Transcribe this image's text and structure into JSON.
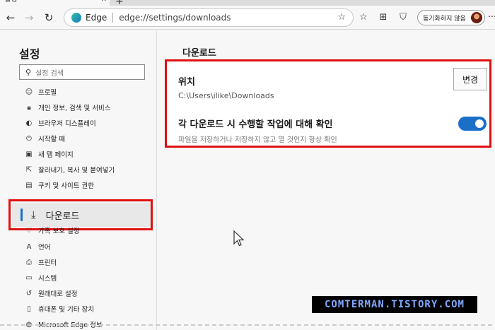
{
  "tab": {
    "title": "설정"
  },
  "toolbar": {
    "site_name": "Edge",
    "url": "edge://settings/downloads",
    "sync_label": "동기화하지 않음"
  },
  "sidebar": {
    "title": "설정",
    "search_placeholder": "설정 검색",
    "items": [
      {
        "label": "프로필",
        "icon": "profile-icon"
      },
      {
        "label": "개인 정보, 검색 및 서비스",
        "icon": "lock-icon"
      },
      {
        "label": "브라우저 디스플레이",
        "icon": "display-icon"
      },
      {
        "label": "시작할 때",
        "icon": "power-icon"
      },
      {
        "label": "새 탭 페이지",
        "icon": "newtab-icon"
      },
      {
        "label": "잘라내기, 복사 및 붙여넣기",
        "icon": "share-icon"
      },
      {
        "label": "쿠키 및 사이트 권한",
        "icon": "cookie-icon"
      },
      {
        "label": "다운로드",
        "icon": "download-icon"
      },
      {
        "label": "가족 보호 설정",
        "icon": "family-icon"
      },
      {
        "label": "언어",
        "icon": "language-icon"
      },
      {
        "label": "프린터",
        "icon": "printer-icon"
      },
      {
        "label": "시스템",
        "icon": "system-icon"
      },
      {
        "label": "원래대로 설정",
        "icon": "reset-icon"
      },
      {
        "label": "휴대폰 및 기타 장치",
        "icon": "phone-icon"
      },
      {
        "label": "Microsoft Edge 정보",
        "icon": "edge-icon"
      }
    ]
  },
  "main": {
    "title": "다운로드",
    "location_label": "위치",
    "location_path": "C:\\Users\\ilike\\Downloads",
    "change_button": "변경",
    "ask_label": "각 다운로드 시 수행할 작업에 대해 확인",
    "ask_desc": "파일을 저장하거나 저장하지 않고 열 것인지 항상 확인",
    "ask_enabled": true
  },
  "watermark": "COMTERMAN.TISTORY.COM",
  "colors": {
    "accent": "#1a6fc9",
    "highlight": "#e01010"
  }
}
